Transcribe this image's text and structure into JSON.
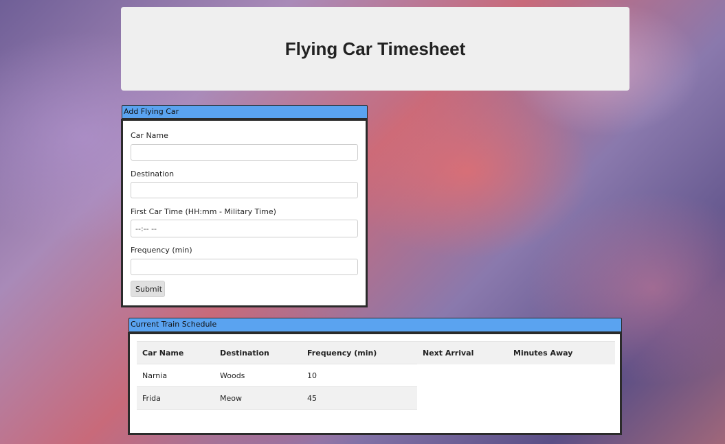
{
  "header": {
    "title": "Flying Car Timesheet"
  },
  "add_panel": {
    "title": "Add Flying Car",
    "fields": [
      {
        "label": "Car Name",
        "value": ""
      },
      {
        "label": "Destination",
        "value": ""
      },
      {
        "label": "First Car Time (HH:mm - Military Time)",
        "placeholder": "--:-- --"
      },
      {
        "label": "Frequency (min)",
        "value": ""
      }
    ],
    "submit_label": "Submit"
  },
  "schedule_panel": {
    "title": "Current Train Schedule",
    "columns": [
      "Car Name",
      "Destination",
      "Frequency (min)",
      "Next Arrival",
      "Minutes Away"
    ],
    "rows": [
      {
        "car_name": "Narnia",
        "destination": "Woods",
        "frequency": "10"
      },
      {
        "car_name": "Frida",
        "destination": "Meow",
        "frequency": "45"
      }
    ]
  }
}
